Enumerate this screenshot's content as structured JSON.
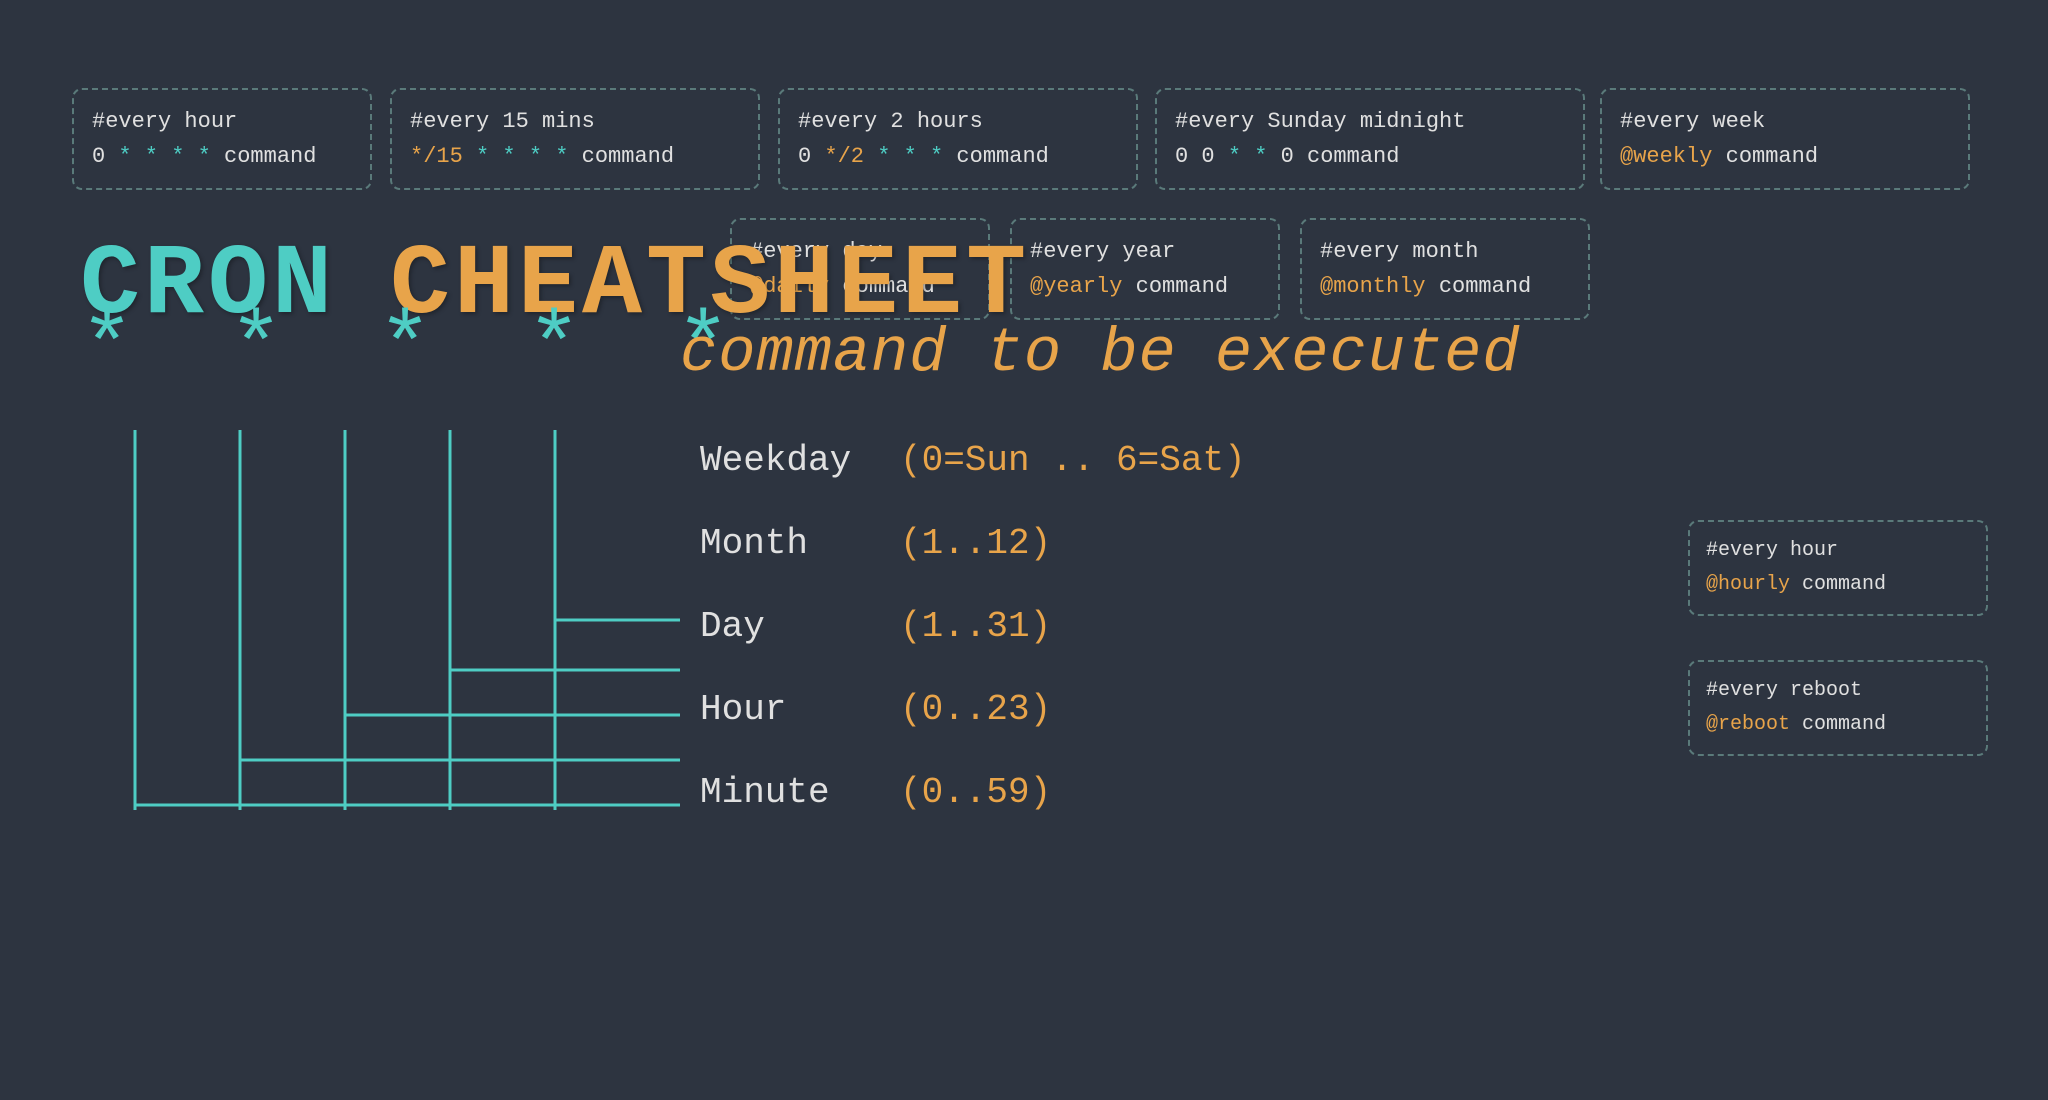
{
  "title": {
    "cron": "CRON",
    "cheatsheet": "CHEATSHEET"
  },
  "command_label": "command  to  be  executed",
  "boxes_top": [
    {
      "id": "every-hour",
      "comment": "#every hour",
      "code_parts": [
        {
          "text": "0 ",
          "class": "normal"
        },
        {
          "text": "* * * *",
          "class": "asterisk"
        },
        {
          "text": " command",
          "class": "normal"
        }
      ]
    },
    {
      "id": "every-15-mins",
      "comment": "#every 15 mins",
      "code_parts": [
        {
          "text": "*/15 ",
          "class": "special"
        },
        {
          "text": "* * * *",
          "class": "asterisk"
        },
        {
          "text": "  command",
          "class": "normal"
        }
      ]
    },
    {
      "id": "every-2-hours",
      "comment": "#every 2 hours",
      "code_parts": [
        {
          "text": "0 ",
          "class": "normal"
        },
        {
          "text": "*/2",
          "class": "special"
        },
        {
          "text": " * * *",
          "class": "asterisk"
        },
        {
          "text": "   command",
          "class": "normal"
        }
      ]
    },
    {
      "id": "every-sunday-midnight",
      "comment": "#every Sunday midnight",
      "code_parts": [
        {
          "text": "0 0 ",
          "class": "normal"
        },
        {
          "text": "* *",
          "class": "asterisk"
        },
        {
          "text": " 0  command",
          "class": "normal"
        }
      ]
    },
    {
      "id": "every-week",
      "comment": "#every week",
      "code_parts": [
        {
          "text": "@weekly",
          "class": "special"
        },
        {
          "text": "  command",
          "class": "normal"
        }
      ]
    }
  ],
  "boxes_middle": [
    {
      "id": "every-day",
      "comment": "#every day",
      "code_parts": [
        {
          "text": "@daily",
          "class": "special"
        },
        {
          "text": "  command",
          "class": "normal"
        }
      ]
    },
    {
      "id": "every-year",
      "comment": "#every year",
      "code_parts": [
        {
          "text": "@yearly",
          "class": "special"
        },
        {
          "text": "  command",
          "class": "normal"
        }
      ]
    },
    {
      "id": "every-month",
      "comment": "#every month",
      "code_parts": [
        {
          "text": "@monthly",
          "class": "special"
        },
        {
          "text": "  command",
          "class": "normal"
        }
      ]
    }
  ],
  "boxes_small": [
    {
      "id": "every-hour-small",
      "comment": "#every hour",
      "code_parts": [
        {
          "text": "@hourly",
          "class": "special"
        },
        {
          "text": "  command",
          "class": "normal"
        }
      ]
    },
    {
      "id": "every-reboot",
      "comment": "#every reboot",
      "code_parts": [
        {
          "text": "@reboot",
          "class": "special"
        },
        {
          "text": "  command",
          "class": "normal"
        }
      ]
    }
  ],
  "stars": [
    "*",
    "*",
    "*",
    "*",
    "*"
  ],
  "labels": [
    {
      "name": "Weekday",
      "range": "(0=Sun .. 6=Sat)"
    },
    {
      "name": "Month",
      "range": "(1..12)"
    },
    {
      "name": "Day",
      "range": "(1..31)"
    },
    {
      "name": "Hour",
      "range": "(0..23)"
    },
    {
      "name": "Minute",
      "range": "(0..59)"
    }
  ],
  "colors": {
    "bg": "#2d3440",
    "teal": "#4ecdc4",
    "orange": "#e8a44a",
    "text": "#e0e0e0",
    "border": "#5a7a7a"
  }
}
